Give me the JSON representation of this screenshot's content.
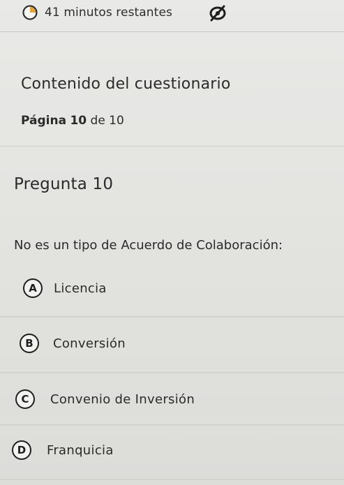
{
  "timer": {
    "text": "41 minutos restantes",
    "icon": "clock-icon",
    "hide_icon": "eye-slash-icon"
  },
  "quiz": {
    "section_title": "Contenido del cuestionario",
    "page_label": "Página",
    "page_current": "10",
    "page_of": "de 10"
  },
  "question": {
    "title": "Pregunta 10",
    "text": "No es un tipo de Acuerdo de Colaboración:",
    "options": [
      {
        "letter": "A",
        "label": "Licencia"
      },
      {
        "letter": "B",
        "label": "Conversión"
      },
      {
        "letter": "C",
        "label": "Convenio de Inversión"
      },
      {
        "letter": "D",
        "label": "Franquicia"
      }
    ]
  },
  "colors": {
    "background": "#e6e6e3",
    "text": "#2b2b2b",
    "timer_icon_accent": "#e8a33a"
  }
}
